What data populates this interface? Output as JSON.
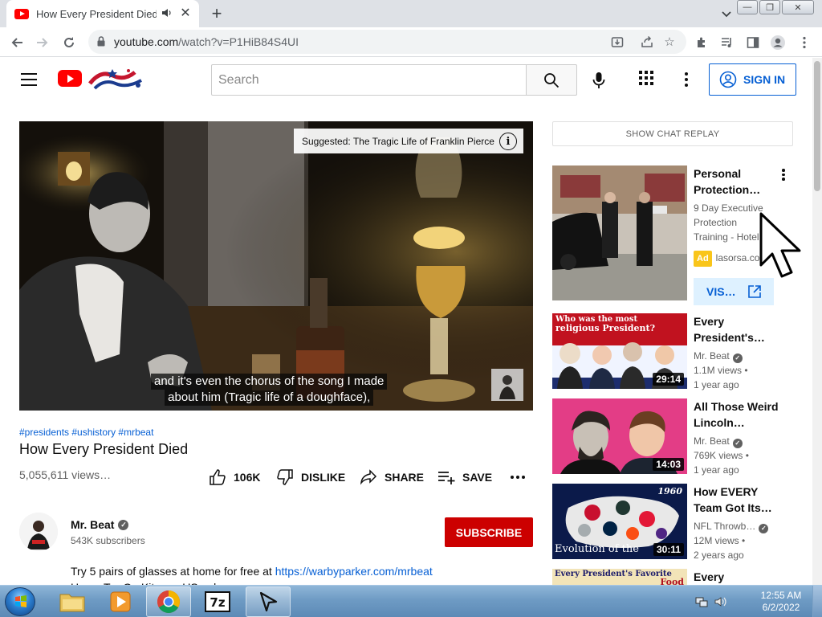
{
  "browser": {
    "tab_title": "How Every President Died - YouTube",
    "new_tab_icon": "plus-icon",
    "url_host": "youtube.com",
    "url_path": "/watch?v=P1HiB84S4UI"
  },
  "header": {
    "search_placeholder": "Search",
    "signin_label": "SIGN IN"
  },
  "video": {
    "suggested_card": "Suggested: The Tragic Life of Franklin Pierce",
    "info_glyph": "i",
    "caption_line1": "and it's even the chorus of the song I made",
    "caption_line2": "about him (Tragic life of a doughface),"
  },
  "meta": {
    "hashtags": "#presidents #ushistory #mrbeat",
    "title": "How Every President Died",
    "views": "5,055,611 views…",
    "like_count": "106K",
    "dislike_label": "DISLIKE",
    "share_label": "SHARE",
    "save_label": "SAVE"
  },
  "channel": {
    "name": "Mr. Beat",
    "subscribers": "543K subscribers",
    "subscribe_label": "SUBSCRIBE"
  },
  "description": {
    "text": "Try 5 pairs of glasses at home for free at ",
    "link": "https://warbyparker.com/mrbeat",
    "line2": "Home Try-On Kits are US only."
  },
  "sidebar": {
    "chat_replay": "SHOW CHAT REPLAY",
    "ad": {
      "title_line1": "Personal",
      "title_line2": "Protection…",
      "desc_line1": "9 Day Executive",
      "desc_line2": "Protection",
      "desc_line3": "Training - Hotel…",
      "badge": "Ad",
      "domain": "lasorsa.com",
      "visit_label": "VIS…"
    },
    "videos": [
      {
        "title_line1": "Every",
        "title_line2": "President's…",
        "channel": "Mr. Beat",
        "views": "1.1M views •",
        "age": "1 year ago",
        "duration": "29:14",
        "thumb_text1": "Who was the most",
        "thumb_text2": "religious President?"
      },
      {
        "title_line1": "All Those Weird",
        "title_line2": "Lincoln…",
        "channel": "Mr. Beat",
        "views": "769K views •",
        "age": "1 year ago",
        "duration": "14:03"
      },
      {
        "title_line1": "How EVERY",
        "title_line2": "Team Got Its…",
        "channel": "NFL Throwb…",
        "views": "12M views •",
        "age": "2 years ago",
        "duration": "30:11",
        "thumb_text1": "Evolution of the",
        "thumb_text2": "1960"
      },
      {
        "title_line1": "Every",
        "thumb_text1": "Every President's Favorite",
        "thumb_text2": "Food"
      }
    ]
  },
  "taskbar": {
    "time": "12:55 AM",
    "date": "6/2/2022"
  },
  "colors": {
    "youtube_red": "#ff0000",
    "link_blue": "#065fd4",
    "subscribe_red": "#cc0000",
    "ad_yellow": "#f9c51a"
  }
}
